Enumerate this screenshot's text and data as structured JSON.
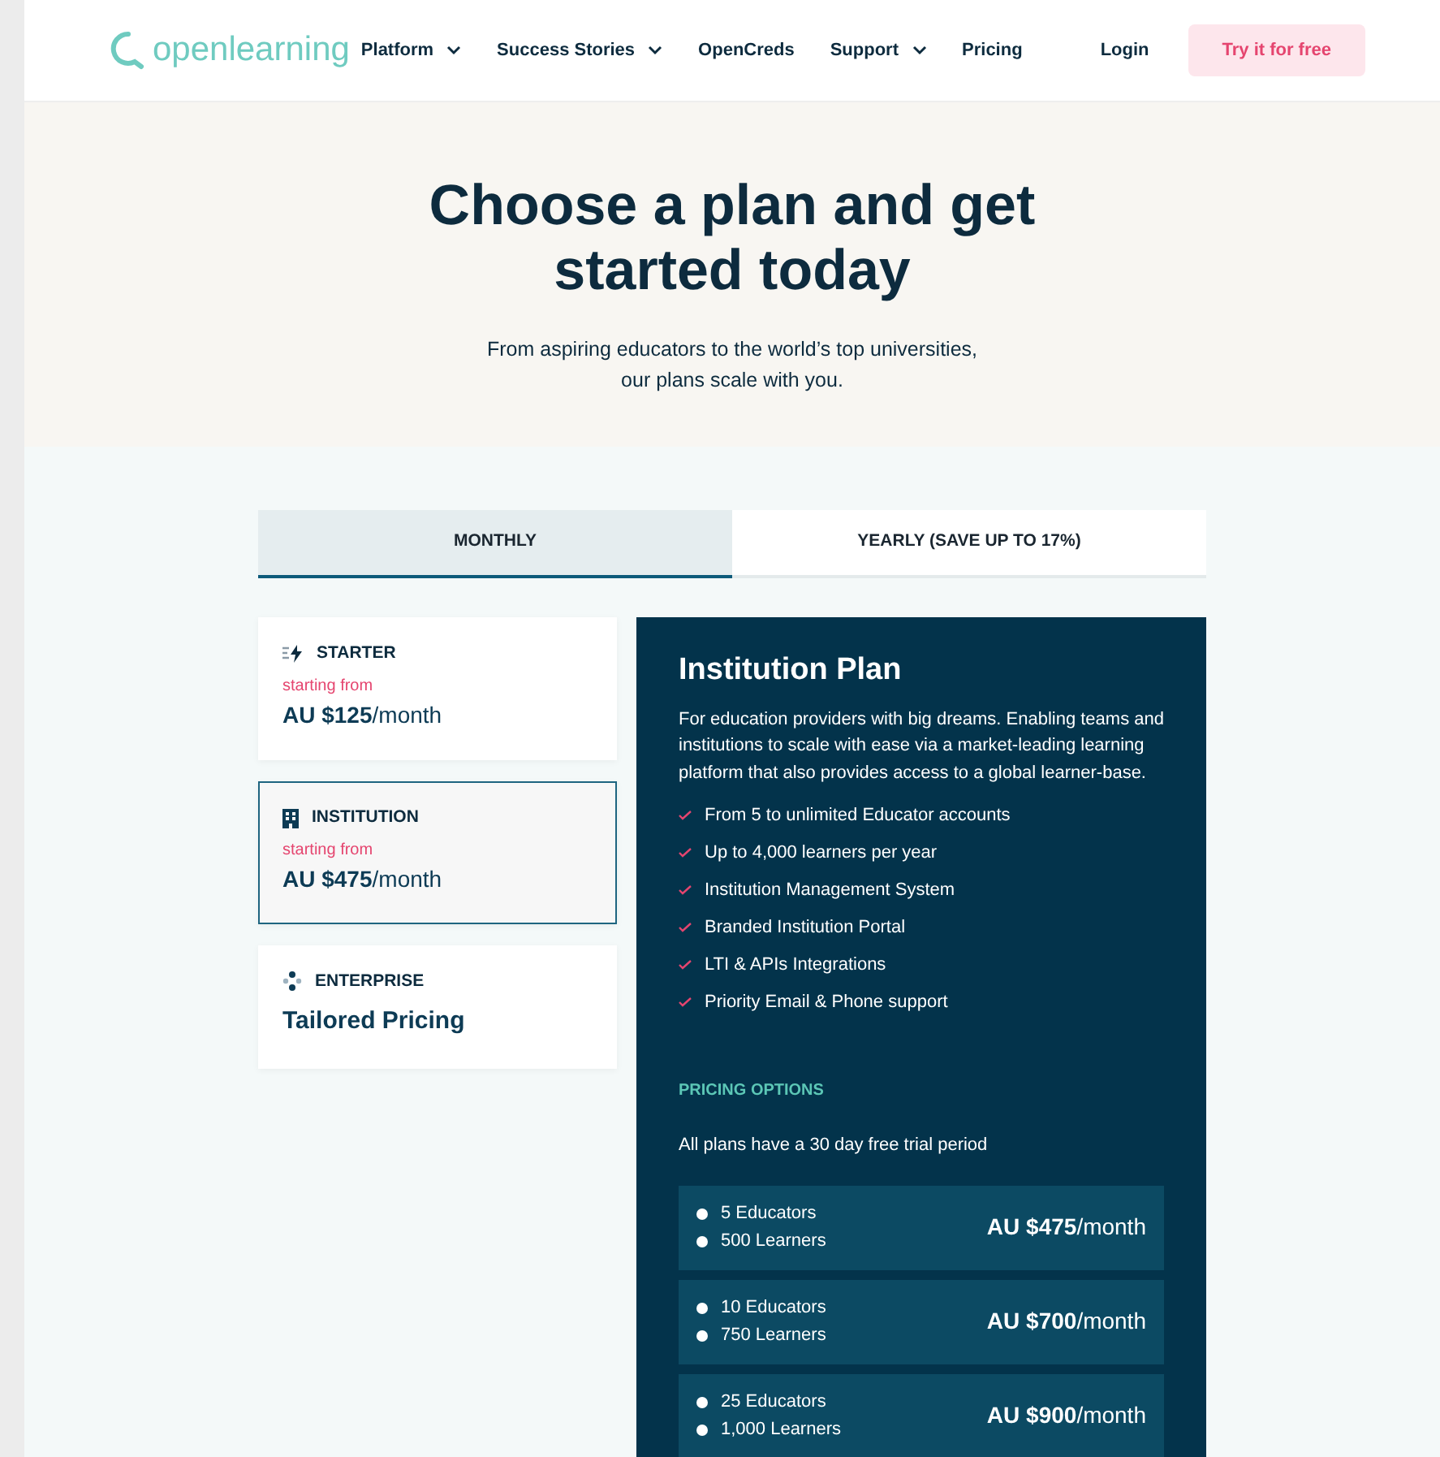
{
  "header": {
    "logo": "openlearning",
    "nav": [
      {
        "label": "Platform",
        "dropdown": true
      },
      {
        "label": "Success Stories",
        "dropdown": true
      },
      {
        "label": "OpenCreds",
        "dropdown": false
      },
      {
        "label": "Support",
        "dropdown": true
      },
      {
        "label": "Pricing",
        "dropdown": false
      }
    ],
    "login": "Login",
    "cta": "Try it for free"
  },
  "hero": {
    "title": "Choose a plan and get started today",
    "subtitle": "From aspiring educators to the world’s top universities, our plans scale with you."
  },
  "billing_tabs": [
    {
      "label": "MONTHLY",
      "selected": true
    },
    {
      "label": "YEARLY (SAVE UP TO 17%)",
      "selected": false
    }
  ],
  "plans": [
    {
      "kind": "starter",
      "name": "STARTER",
      "caption": "starting from",
      "price": "**AU $125**/month",
      "selected": false
    },
    {
      "kind": "institution",
      "name": "INSTITUTION",
      "caption": "starting from",
      "price": "**AU $475**/month",
      "selected": true
    },
    {
      "kind": "enterprise",
      "name": "ENTERPRISE",
      "price": "Tailored Pricing",
      "selected": false
    }
  ],
  "detail": {
    "title": "Institution Plan",
    "description": "For education providers with big dreams. Enabling teams and institutions to scale with ease via a market-leading learning platform that also provides access to a global learner-base.",
    "features": [
      "From 5 to unlimited Educator accounts",
      "Up to 4,000 learners per year",
      "Institution Management System",
      "Branded Institution Portal",
      "LTI & APIs Integrations",
      "Priority Email & Phone support"
    ],
    "options_heading": "PRICING OPTIONS",
    "trial_note": "All plans have a 30 day free trial period",
    "options": [
      {
        "items": [
          "5 Educators",
          "500 Learners"
        ],
        "price": "**AU $475**/month"
      },
      {
        "items": [
          "10 Educators",
          "750 Learners"
        ],
        "price": "**AU $700**/month"
      },
      {
        "items": [
          "25 Educators",
          "1,000 Learners"
        ],
        "price": "**AU $900**/month"
      }
    ]
  }
}
